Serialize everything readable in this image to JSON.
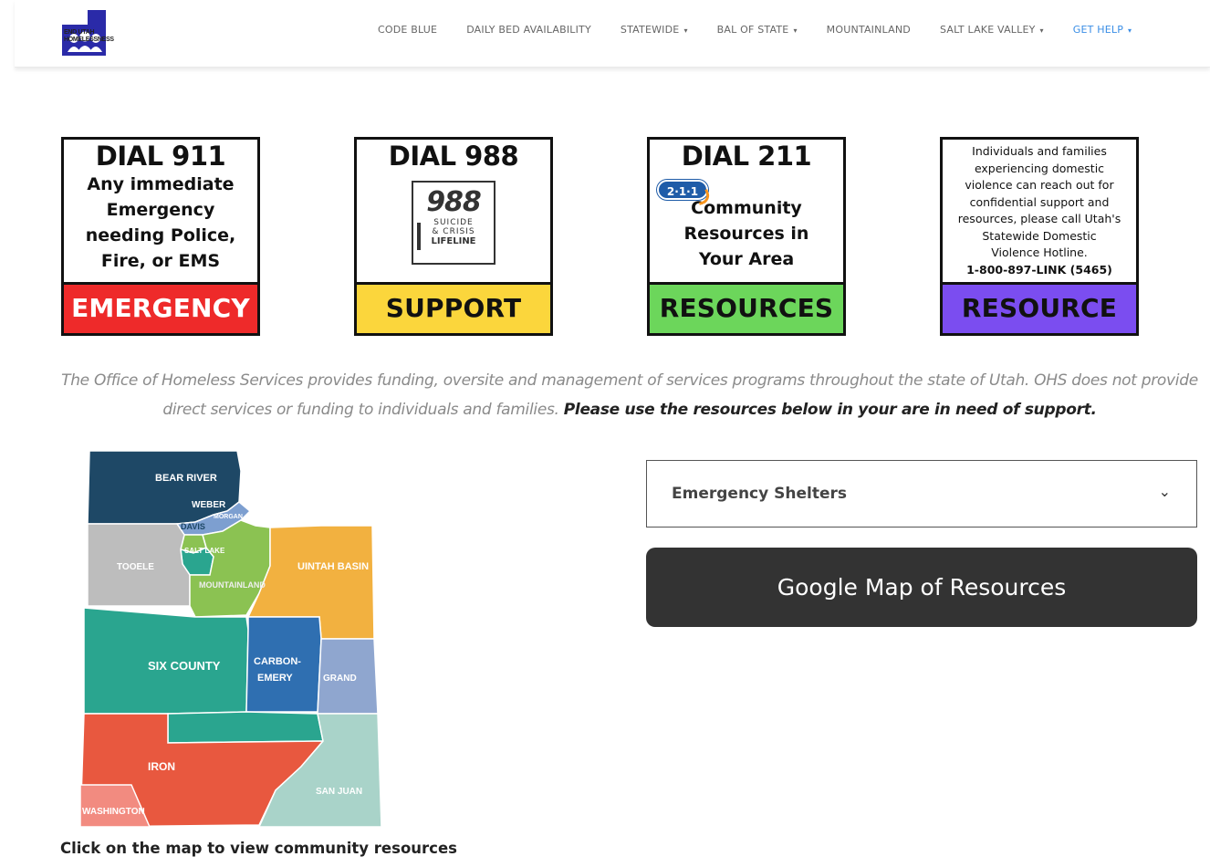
{
  "brand": {
    "logo_text_line1": "END UTAH",
    "logo_text_line2": "HOMELESSNESS"
  },
  "nav": {
    "items": [
      {
        "label": "CODE BLUE",
        "dropdown": false
      },
      {
        "label": "DAILY BED AVAILABILITY",
        "dropdown": false
      },
      {
        "label": "STATEWIDE",
        "dropdown": true
      },
      {
        "label": "BAL OF STATE",
        "dropdown": true
      },
      {
        "label": "MOUNTAINLAND",
        "dropdown": false
      },
      {
        "label": "SALT LAKE VALLEY",
        "dropdown": true
      },
      {
        "label": "GET HELP",
        "dropdown": true,
        "active": true
      }
    ],
    "caret": "▾"
  },
  "cards": {
    "c911": {
      "title": "DIAL 911",
      "body": [
        "Any immediate",
        "Emergency",
        "needing Police,",
        "Fire, or EMS"
      ],
      "label": "EMERGENCY",
      "color": "#ee2a2a"
    },
    "c988": {
      "title": "DIAL 988",
      "logo_num": "988",
      "logo_sub": [
        "SUICIDE",
        "& CRISIS"
      ],
      "logo_sub2": "LIFELINE",
      "label": "SUPPORT",
      "color": "#fbd63c"
    },
    "c211": {
      "title": "DIAL 211",
      "badge": "2·1·1",
      "body": [
        "Community",
        "Resources in",
        "Your Area"
      ],
      "label": "RESOURCES",
      "color": "#6cd65b"
    },
    "cdv": {
      "body": [
        "Individuals and families",
        "experiencing domestic",
        "violence can reach out for",
        "confidential support and",
        "resources, please call Utah's",
        "Statewide Domestic",
        "Violence Hotline."
      ],
      "phone": "1-800-897-LINK (5465)",
      "label": "RESOURCE",
      "color": "#7b4df0"
    }
  },
  "intro": {
    "text": "The Office of Homeless Services provides funding, oversite and management of services programs throughout the state of Utah. OHS does not provide direct services or funding to individuals and families.",
    "emphasis": "Please use the resources below in your are in need of support."
  },
  "map": {
    "regions": [
      "BEAR RIVER",
      "WEBER",
      "MORGAN",
      "DAVIS",
      "SALT LAKE",
      "TOOELE",
      "UINTAH BASIN",
      "MOUNTAINLAND",
      "SIX COUNTY",
      "CARBON-",
      "EMERY",
      "GRAND",
      "IRON",
      "SAN JUAN",
      "WASHINGTON"
    ],
    "caption": "Click on the map to view community resources"
  },
  "resources": {
    "select_value": "Emergency Shelters",
    "chevron": "⌄",
    "map_button": "Google Map of Resources"
  }
}
